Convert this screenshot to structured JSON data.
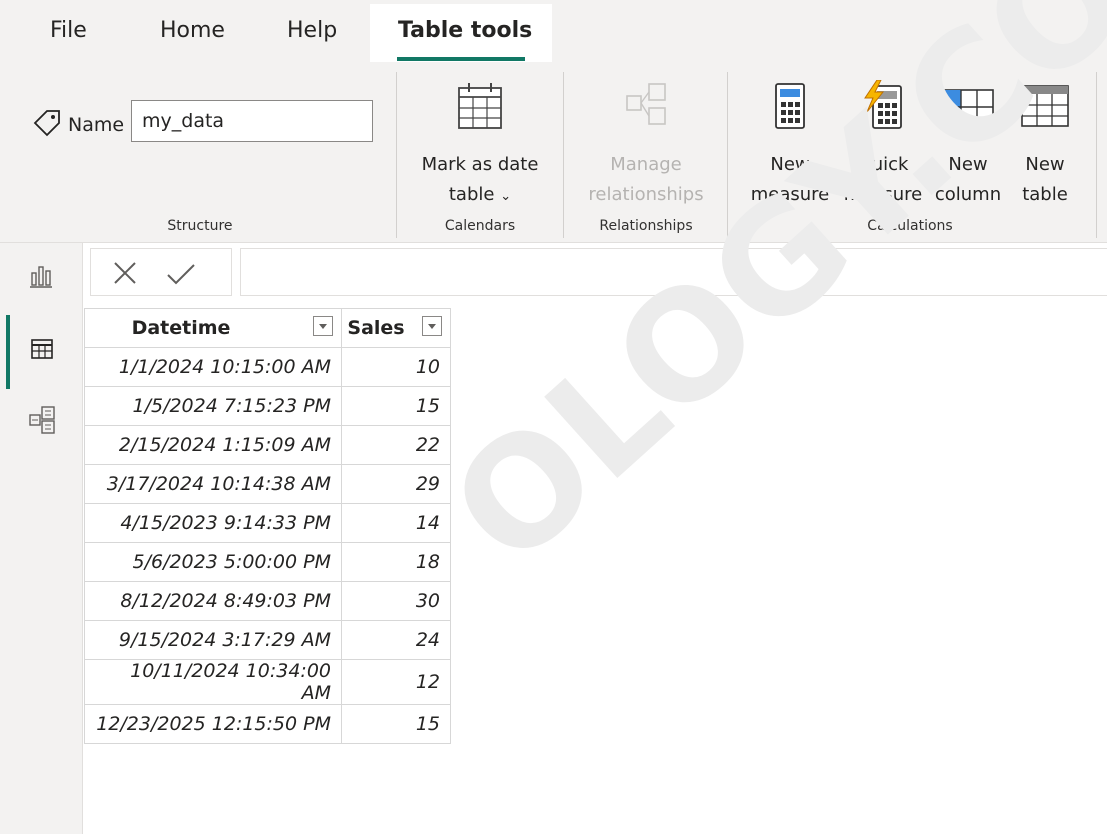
{
  "tabs": {
    "file": "File",
    "home": "Home",
    "help": "Help",
    "table_tools": "Table tools"
  },
  "structure": {
    "name_label": "Name",
    "name_value": "my_data",
    "group_label": "Structure"
  },
  "calendars": {
    "mark_line1": "Mark as date",
    "mark_line2": "table",
    "group_label": "Calendars"
  },
  "relationships": {
    "manage_line1": "Manage",
    "manage_line2": "relationships",
    "group_label": "Relationships"
  },
  "calculations": {
    "new_measure_line1": "New",
    "new_measure_line2": "measure",
    "quick_measure_line1": "Quick",
    "quick_measure_line2": "measure",
    "new_column_line1": "New",
    "new_column_line2": "column",
    "new_table_line1": "New",
    "new_table_line2": "table",
    "group_label": "Calculations"
  },
  "table": {
    "columns": [
      "Datetime",
      "Sales"
    ],
    "rows": [
      [
        "1/1/2024 10:15:00 AM",
        "10"
      ],
      [
        "1/5/2024 7:15:23 PM",
        "15"
      ],
      [
        "2/15/2024 1:15:09 AM",
        "22"
      ],
      [
        "3/17/2024 10:14:38 AM",
        "29"
      ],
      [
        "4/15/2023 9:14:33 PM",
        "14"
      ],
      [
        "5/6/2023 5:00:00 PM",
        "18"
      ],
      [
        "8/12/2024 8:49:03 PM",
        "30"
      ],
      [
        "9/15/2024 3:17:29 AM",
        "24"
      ],
      [
        "10/11/2024 10:34:00 AM",
        "12"
      ],
      [
        "12/23/2025 12:15:50 PM",
        "15"
      ]
    ]
  },
  "watermark": "OLOGY.CO",
  "colors": {
    "accent": "#117865",
    "ribbon_bg": "#f3f2f1"
  }
}
